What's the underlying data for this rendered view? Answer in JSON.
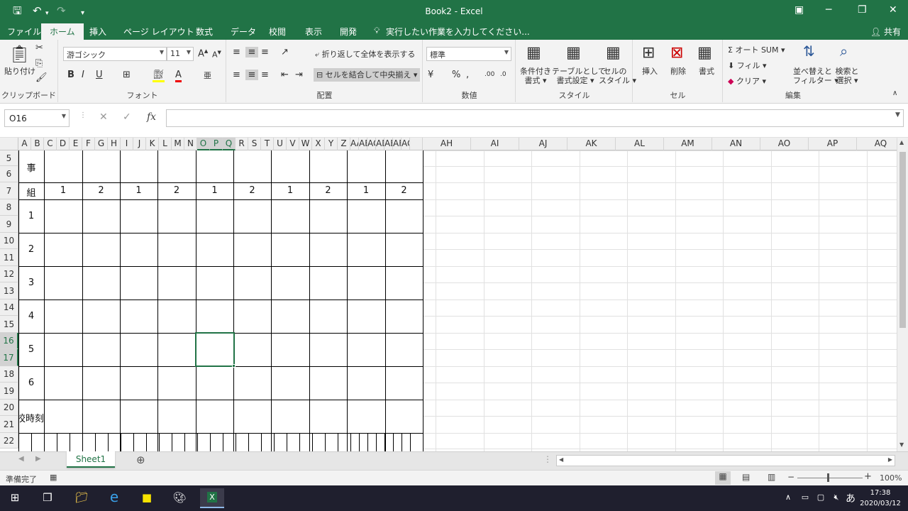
{
  "titlebar": {
    "title": "Book2 - Excel",
    "save_icon": "save-icon",
    "undo_icon": "undo-icon",
    "redo_icon": "redo-icon"
  },
  "tabs": [
    {
      "label": "ファイル",
      "active": false
    },
    {
      "label": "ホーム",
      "active": true
    },
    {
      "label": "挿入",
      "active": false
    },
    {
      "label": "ページ レイアウト",
      "active": false
    },
    {
      "label": "数式",
      "active": false
    },
    {
      "label": "データ",
      "active": false
    },
    {
      "label": "校閲",
      "active": false
    },
    {
      "label": "表示",
      "active": false
    },
    {
      "label": "開発",
      "active": false
    }
  ],
  "tell_me": "実行したい作業を入力してください...",
  "share_label": "共有",
  "ribbon": {
    "clipboard": {
      "paste": "貼り付け",
      "group": "クリップボード"
    },
    "font": {
      "name": "游ゴシック",
      "size": "11",
      "group": "フォント",
      "bold": "B",
      "italic": "I",
      "underline": "U"
    },
    "alignment": {
      "wrap": "折り返して全体を表示する",
      "merge": "セルを結合して中央揃え",
      "group": "配置"
    },
    "number": {
      "format": "標準",
      "group": "数値"
    },
    "styles": {
      "conditional": [
        "条件付き",
        "書式"
      ],
      "table": [
        "テーブルとして",
        "書式設定"
      ],
      "cell": [
        "セルの",
        "スタイル"
      ],
      "group": "スタイル"
    },
    "cells": {
      "insert": "挿入",
      "delete": "削除",
      "format": "書式",
      "group": "セル"
    },
    "editing": {
      "autosum": "オート SUM",
      "fill": "フィル",
      "clear": "クリア",
      "sort": [
        "並べ替えと",
        "フィルター"
      ],
      "find": [
        "検索と",
        "選択"
      ],
      "group": "編集"
    }
  },
  "namebox": "O16",
  "fx_label": "fx",
  "columns_narrow": [
    "A",
    "B",
    "C",
    "D",
    "E",
    "F",
    "G",
    "H",
    "I",
    "J",
    "K",
    "L",
    "M",
    "N",
    "O",
    "P",
    "Q",
    "R",
    "S",
    "T",
    "U",
    "V",
    "W",
    "X",
    "Y",
    "Z",
    "AA",
    "AB",
    "AC",
    "AD",
    "AE",
    "AF",
    "AG"
  ],
  "columns_wide": [
    "AH",
    "AI",
    "AJ",
    "AK",
    "AL",
    "AM",
    "AN",
    "AO",
    "AP",
    "AQ"
  ],
  "selected_columns": [
    "O",
    "P",
    "Q"
  ],
  "rows": [
    "5",
    "6",
    "7",
    "8",
    "9",
    "10",
    "11",
    "12",
    "13",
    "14",
    "15",
    "16",
    "17",
    "18",
    "19",
    "20",
    "21",
    "22"
  ],
  "selected_rows": [
    "16",
    "17"
  ],
  "table": {
    "top_label": "事",
    "group_header": "組",
    "group_values": [
      "1",
      "2",
      "1",
      "2",
      "1",
      "2",
      "1",
      "2",
      "1",
      "2"
    ],
    "row_labels": [
      "1",
      "2",
      "3",
      "4",
      "5",
      "6"
    ],
    "bottom_label": "下校時刻"
  },
  "sheet_tab": "Sheet1",
  "status": {
    "ready": "準備完了",
    "zoom": "100%"
  },
  "taskbar": {
    "time": "17:38",
    "date": "2020/03/12",
    "ime": "あ"
  }
}
